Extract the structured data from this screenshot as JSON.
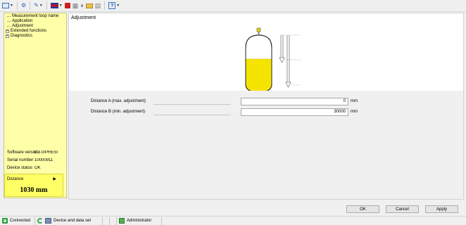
{
  "toolbar": {
    "icons": [
      "monitor-icon",
      "tool-icon",
      "wrench-icon",
      "flag-icon",
      "stop-icon",
      "grid-icon",
      "pause-icon",
      "folder-icon",
      "note-icon",
      "help-icon"
    ]
  },
  "tree": {
    "items": [
      {
        "label": "Measurement loop name",
        "expandable": false
      },
      {
        "label": "Application",
        "expandable": false
      },
      {
        "label": "Adjustment",
        "expandable": false
      },
      {
        "label": "Extended functions",
        "expandable": true,
        "expander": "+"
      },
      {
        "label": "Diagnostics",
        "expandable": true,
        "expander": "+"
      }
    ]
  },
  "device_info": {
    "software_version_label": "Software version",
    "software_version_value": "0.3.0/PRESI",
    "serial_number_label": "Serial number",
    "serial_number_value": "10000911",
    "device_status_label": "Device status",
    "device_status_value": "OK"
  },
  "measurement": {
    "label": "Distance",
    "arrow": "▶",
    "value": "1030 mm"
  },
  "content": {
    "title": "Adjustment"
  },
  "settings": {
    "distance_a_label": "Distance A (max. adjustment)",
    "distance_a_value": "0",
    "distance_a_unit": "mm",
    "distance_b_label": "Distance B (min. adjustment)",
    "distance_b_value": "30000",
    "distance_b_unit": "mm"
  },
  "buttons": {
    "ok": "OK",
    "cancel": "Cancel",
    "apply": "Apply"
  },
  "status": {
    "connected": "Connected",
    "device_and_data_set": "Device and data set",
    "user": "Administrator"
  },
  "colors": {
    "panel_background": "#ffffa8",
    "measurement_box": "#ffff66",
    "liquid": "#f5e400"
  }
}
